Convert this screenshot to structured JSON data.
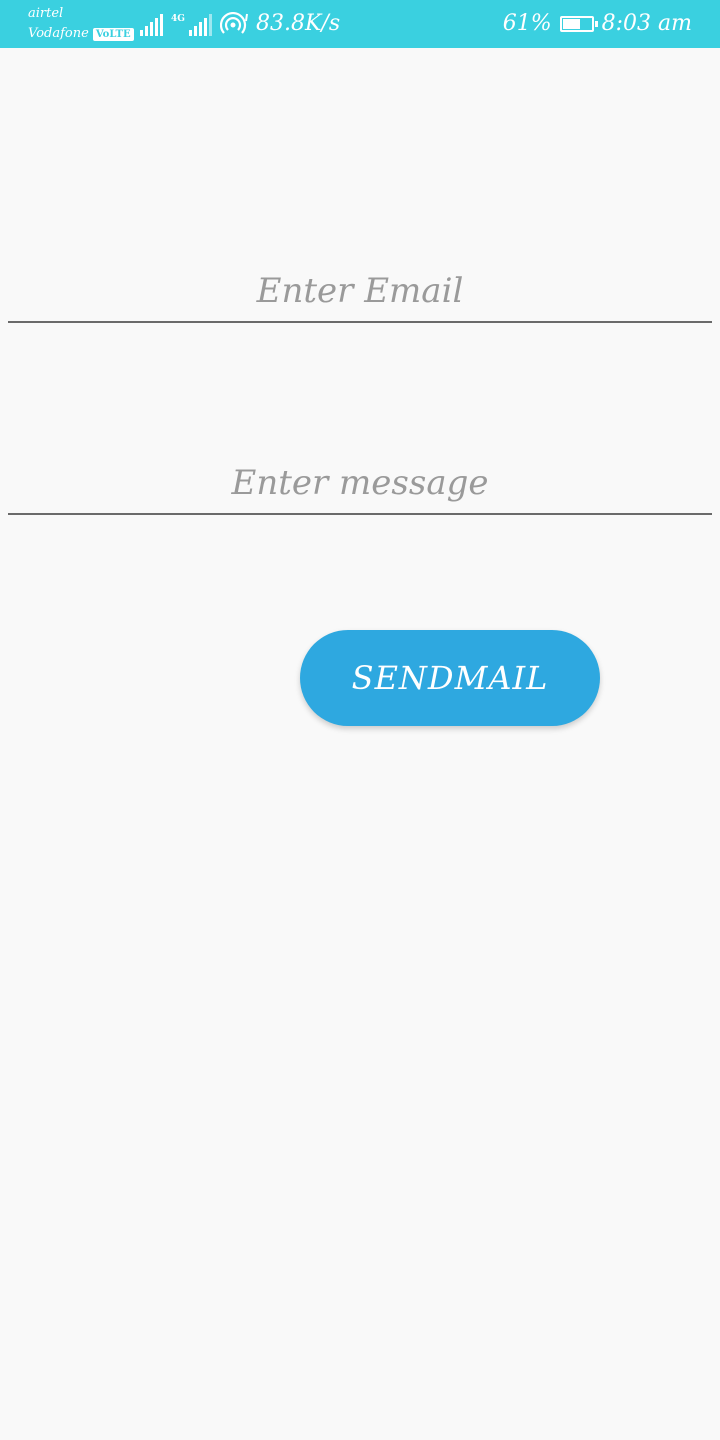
{
  "status_bar": {
    "carrier_1": "airtel",
    "carrier_2": "Vodafone",
    "volte_badge": "VoLTE",
    "network_type": "4G",
    "speed": "83.8K/s",
    "battery_percent_text": "61%",
    "battery_level": 0.61,
    "time": "8:03 am",
    "icons": [
      "signal-icon",
      "signal-4g-icon",
      "hotspot-icon",
      "battery-icon"
    ],
    "background_color": "#3ad0e0"
  },
  "form": {
    "email_placeholder": "Enter Email",
    "email_value": "",
    "message_placeholder": "Enter message",
    "message_value": ""
  },
  "send_button": {
    "label": "SENDMAIL",
    "color": "#2ea8e0"
  }
}
